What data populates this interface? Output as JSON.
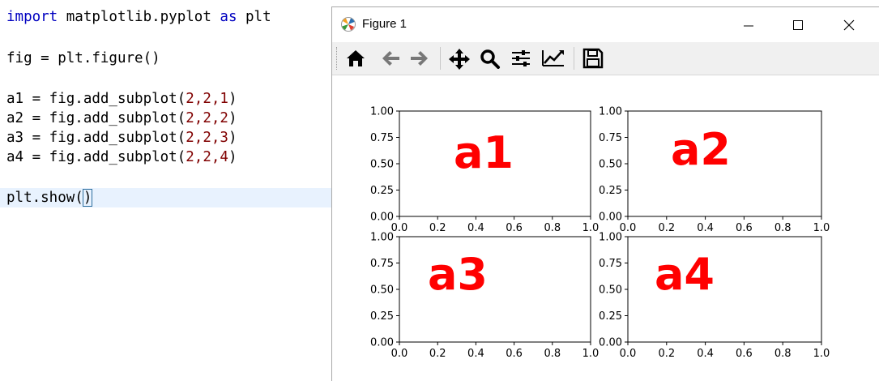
{
  "editor": {
    "lines": {
      "l1": {
        "kw1": "import",
        "mid": " matplotlib.pyplot ",
        "kw2": "as",
        "end": " plt"
      },
      "l2": {
        "text": "fig = plt.figure()"
      },
      "l3": {
        "pre": "a1 = fig.add_subplot(",
        "args": "2,2,1",
        "post": ")"
      },
      "l4": {
        "pre": "a2 = fig.add_subplot(",
        "args": "2,2,2",
        "post": ")"
      },
      "l5": {
        "pre": "a3 = fig.add_subplot(",
        "args": "2,2,3",
        "post": ")"
      },
      "l6": {
        "pre": "a4 = fig.add_subplot(",
        "args": "2,2,4",
        "post": ")"
      },
      "l7": {
        "pre": "plt.show(",
        "cursor": ")"
      }
    }
  },
  "window": {
    "title": "Figure 1",
    "toolbar": [
      "home-icon",
      "back-icon",
      "forward-icon",
      "pan-icon",
      "zoom-icon",
      "subplots-icon",
      "customize-icon",
      "save-icon"
    ]
  },
  "figure": {
    "ticks": [
      "0.00",
      "0.25",
      "0.50",
      "0.75",
      "1.00"
    ],
    "xticks": [
      "0.0",
      "0.2",
      "0.4",
      "0.6",
      "0.8",
      "1.0"
    ],
    "annotation_color": "#ff0000",
    "axes": [
      {
        "label": "a1"
      },
      {
        "label": "a2"
      },
      {
        "label": "a3"
      },
      {
        "label": "a4"
      }
    ]
  }
}
